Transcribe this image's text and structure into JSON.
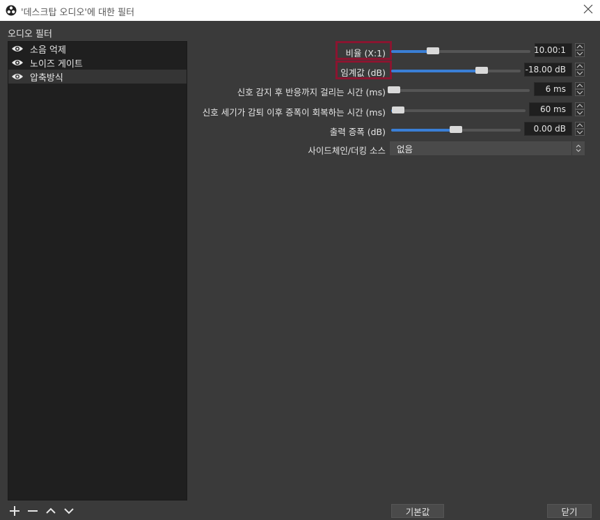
{
  "window": {
    "title": "'데스크탑 오디오'에 대한 필터"
  },
  "filters_panel": {
    "label": "오디오 필터",
    "items": [
      {
        "label": "소음 억제"
      },
      {
        "label": "노이즈 게이트"
      },
      {
        "label": "압축방식"
      }
    ]
  },
  "properties": {
    "ratio": {
      "label": "비율 (X:1)",
      "value": "10.00:1",
      "slider_fraction": 0.3
    },
    "threshold": {
      "label": "임계값 (dB)",
      "value": "-18.00 dB",
      "slider_fraction": 0.7
    },
    "attack": {
      "label": "신호 감지 후 반응까지 걸리는 시간 (ms)",
      "value": "6 ms",
      "slider_fraction": 0.02
    },
    "release": {
      "label": "신호 세기가 감퇴 이후 증폭이 회복하는 시간 (ms)",
      "value": "60 ms",
      "slider_fraction": 0.05
    },
    "output_gain": {
      "label": "출력 증폭 (dB)",
      "value": "0.00 dB",
      "slider_fraction": 0.5
    },
    "sidechain": {
      "label": "사이드체인/더킹 소스",
      "value": "없음"
    }
  },
  "buttons": {
    "defaults": "기본값",
    "close": "닫기"
  },
  "colors": {
    "accent": "#3a7fd6",
    "highlight": "#8a1530",
    "background": "#3a3a3a"
  }
}
